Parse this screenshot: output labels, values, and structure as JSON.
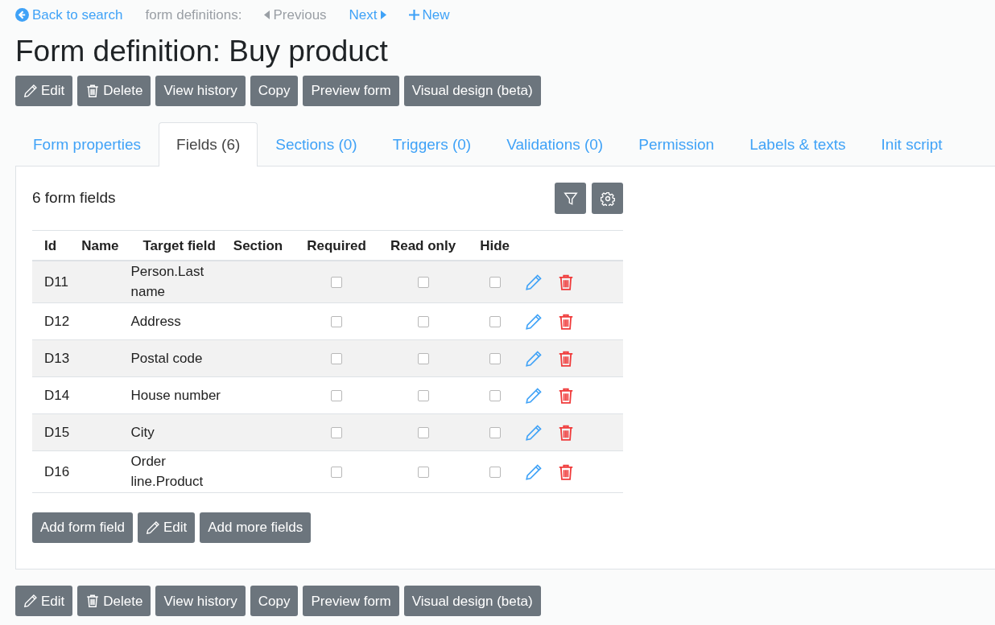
{
  "nav": {
    "back": "Back to search",
    "context": "form definitions:",
    "links": [
      {
        "kind": "prev",
        "label": "Previous",
        "disabled": true
      },
      {
        "kind": "next",
        "label": "Next",
        "disabled": false
      },
      {
        "kind": "new",
        "label": "New",
        "disabled": false
      }
    ]
  },
  "title": "Form definition: Buy product",
  "actions": [
    {
      "kind": "edit",
      "label": "Edit"
    },
    {
      "kind": "delete",
      "label": "Delete"
    },
    {
      "kind": "plain",
      "label": "View history"
    },
    {
      "kind": "plain",
      "label": "Copy"
    },
    {
      "kind": "plain",
      "label": "Preview form"
    },
    {
      "kind": "plain",
      "label": "Visual design (beta)"
    }
  ],
  "tabs": [
    {
      "label": "Form properties",
      "selected": false
    },
    {
      "label": "Fields (6)",
      "selected": true
    },
    {
      "label": "Sections (0)",
      "selected": false
    },
    {
      "label": "Triggers (0)",
      "selected": false
    },
    {
      "label": "Validations (0)",
      "selected": false
    },
    {
      "label": "Permission",
      "selected": false
    },
    {
      "label": "Labels & texts",
      "selected": false
    },
    {
      "label": "Init script",
      "selected": false
    }
  ],
  "panel": {
    "count": "6 form fields",
    "table": {
      "columns": [
        "Id",
        "Name",
        "Target field",
        "Section",
        "Required",
        "Read only",
        "Hide"
      ],
      "rows": [
        {
          "id": "D11",
          "target": "Person.Last name",
          "required": false,
          "read_only": false,
          "hide": false
        },
        {
          "id": "D12",
          "target": "Address",
          "required": false,
          "read_only": false,
          "hide": false
        },
        {
          "id": "D13",
          "target": "Postal code",
          "required": false,
          "read_only": false,
          "hide": false
        },
        {
          "id": "D14",
          "target": "House number",
          "required": false,
          "read_only": false,
          "hide": false
        },
        {
          "id": "D15",
          "target": "City",
          "required": false,
          "read_only": false,
          "hide": false
        },
        {
          "id": "D16",
          "target": "Order line.Product",
          "required": false,
          "read_only": false,
          "hide": false
        }
      ]
    },
    "buttons": [
      {
        "kind": "plain",
        "label": "Add form field"
      },
      {
        "kind": "edit",
        "label": "Edit"
      },
      {
        "kind": "plain",
        "label": "Add more fields"
      }
    ]
  },
  "bottom_actions": [
    {
      "kind": "edit",
      "label": "Edit"
    },
    {
      "kind": "delete",
      "label": "Delete"
    },
    {
      "kind": "plain",
      "label": "View history"
    },
    {
      "kind": "plain",
      "label": "Copy"
    },
    {
      "kind": "plain",
      "label": "Preview form"
    },
    {
      "kind": "plain",
      "label": "Visual design (beta)"
    }
  ]
}
